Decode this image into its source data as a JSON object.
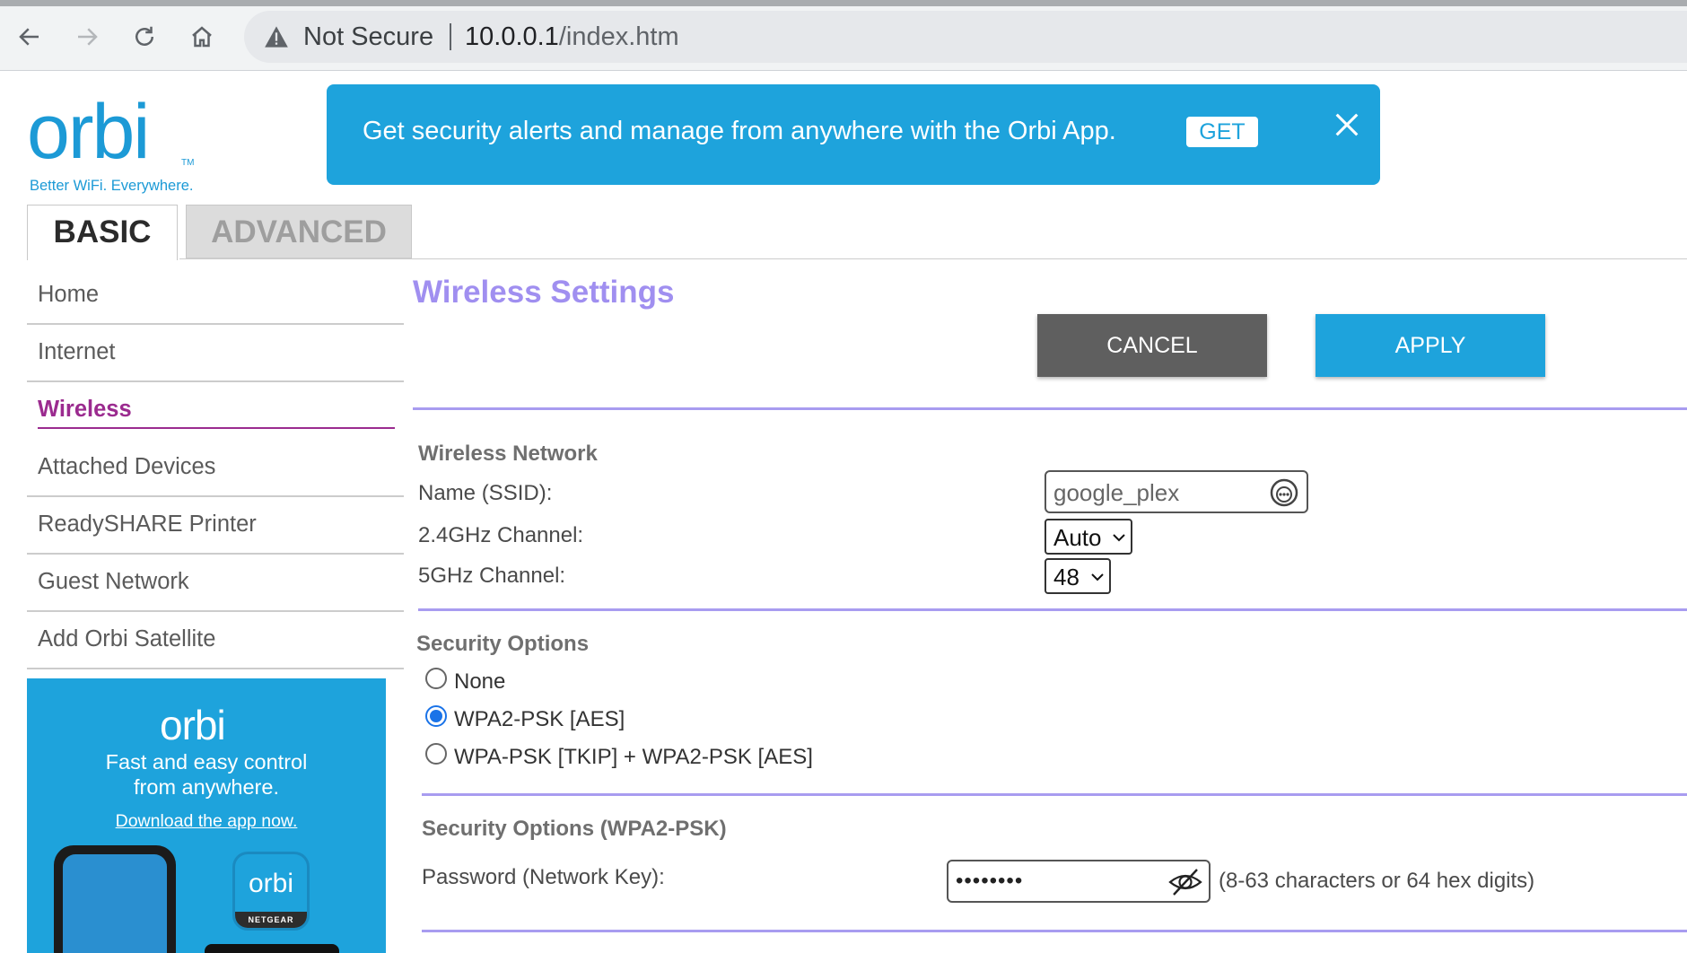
{
  "browser": {
    "security_label": "Not Secure",
    "url_host": "10.0.0.1",
    "url_path": "/index.htm",
    "icons": [
      "back-icon",
      "forward-icon",
      "reload-icon",
      "home-icon",
      "warning-icon"
    ]
  },
  "logo": {
    "wordmark": "orbi",
    "trademark": "TM",
    "tagline": "Better WiFi. Everywhere."
  },
  "banner": {
    "message": "Get security alerts and manage from anywhere with the Orbi App.",
    "get_label": "GET"
  },
  "tabs": [
    {
      "label": "BASIC",
      "active": true
    },
    {
      "label": "ADVANCED",
      "active": false
    }
  ],
  "sidebar": {
    "items": [
      {
        "label": "Home"
      },
      {
        "label": "Internet"
      },
      {
        "label": "Wireless",
        "active": true
      },
      {
        "label": "Attached Devices"
      },
      {
        "label": "ReadySHARE Printer"
      },
      {
        "label": "Guest Network"
      },
      {
        "label": "Add Orbi Satellite"
      }
    ]
  },
  "promo": {
    "wordmark": "orbi",
    "line1": "Fast and easy control",
    "line2": "from anywhere.",
    "link": "Download the app now.",
    "app_icon_word": "orbi",
    "app_icon_brand": "NETGEAR"
  },
  "main": {
    "title": "Wireless Settings",
    "cancel_label": "CANCEL",
    "apply_label": "APPLY",
    "wireless_network": {
      "heading": "Wireless Network",
      "ssid_label": "Name (SSID):",
      "ssid_value": "google_plex",
      "ch24_label": "2.4GHz Channel:",
      "ch24_value": "Auto",
      "ch5_label": "5GHz Channel:",
      "ch5_value": "48"
    },
    "security_options": {
      "heading": "Security Options",
      "options": [
        {
          "label": "None",
          "checked": false
        },
        {
          "label": "WPA2-PSK [AES]",
          "checked": true
        },
        {
          "label": "WPA-PSK [TKIP] + WPA2-PSK [AES]",
          "checked": false
        }
      ]
    },
    "wpa2": {
      "heading": "Security Options (WPA2-PSK)",
      "password_label": "Password (Network Key):",
      "password_mask": "••••••••",
      "hint": "(8-63 characters or 64 hex digits)"
    }
  },
  "colors": {
    "brand_blue": "#1ea3dc",
    "title_purple": "#a08ff0",
    "active_magenta": "#9b2b8f",
    "cancel_gray": "#5f5f5f",
    "divider_lavender": "#a89cf0"
  }
}
